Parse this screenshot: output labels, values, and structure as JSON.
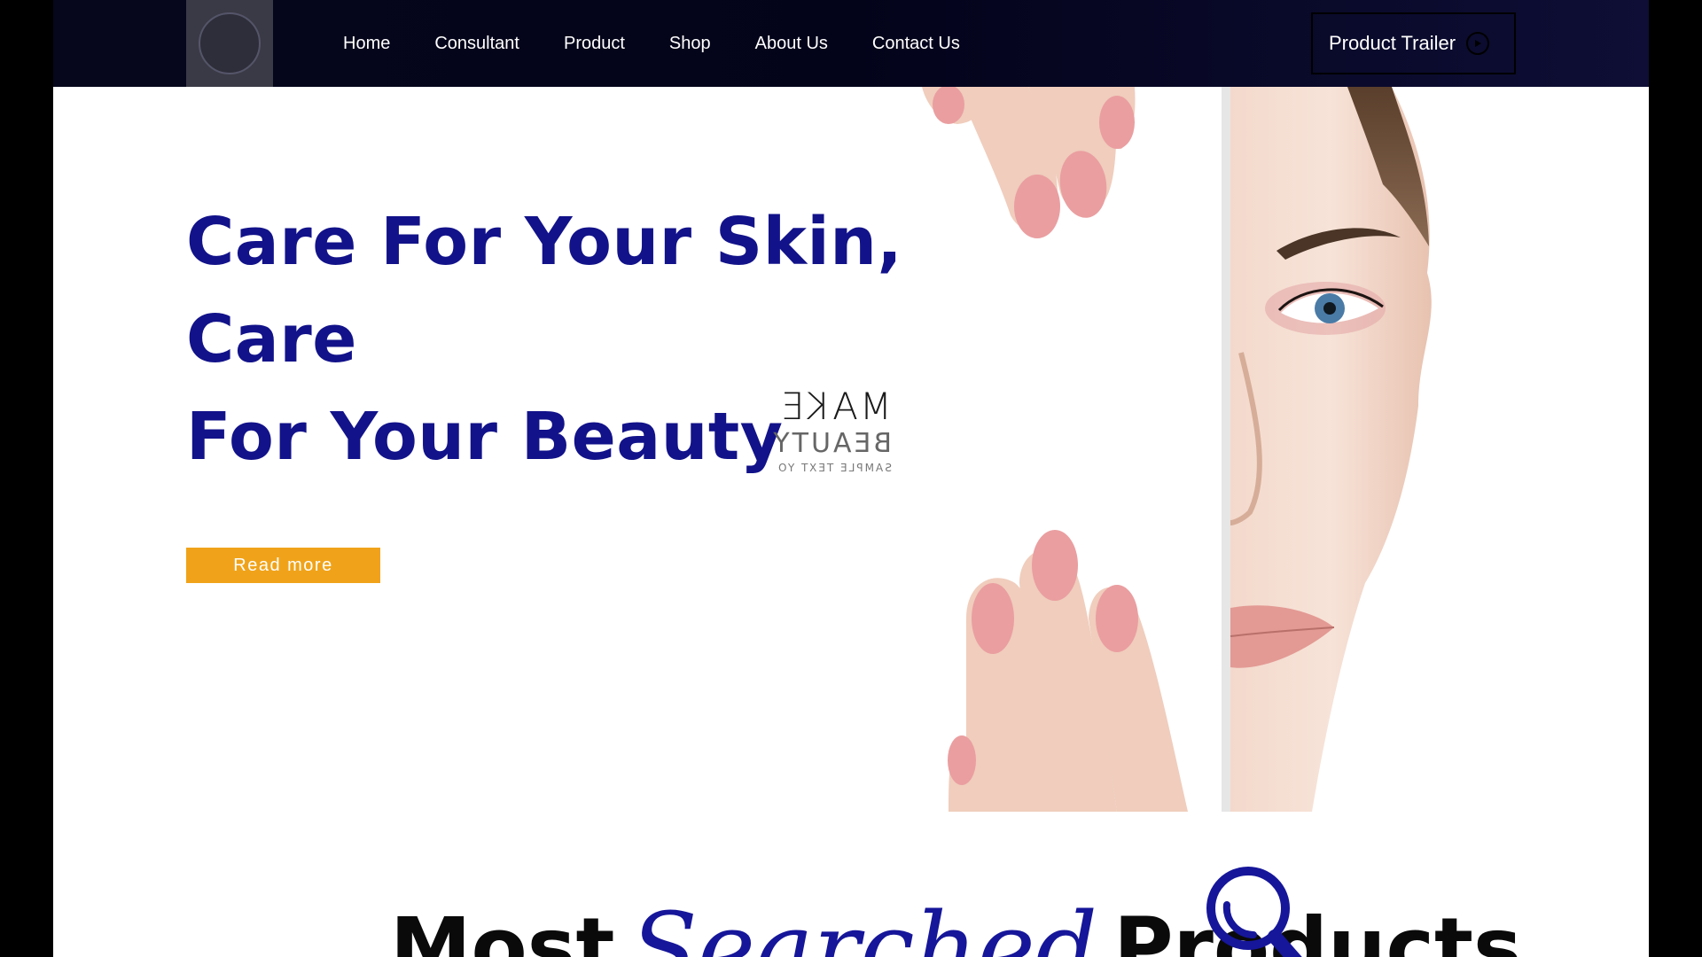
{
  "nav": {
    "items": [
      {
        "label": "Home"
      },
      {
        "label": "Consultant"
      },
      {
        "label": "Product"
      },
      {
        "label": "Shop"
      },
      {
        "label": "About Us"
      },
      {
        "label": "Contact Us"
      }
    ],
    "trailer_label": "Product Trailer"
  },
  "hero": {
    "title_line1": "Care For Your Skin, Care",
    "title_line2": "For Your Beauty",
    "button_label": "Read more",
    "brand_mirrored": {
      "line1": "MAKE",
      "line2": "BEAUTY",
      "line3": "SAMPLE TEXT YO"
    }
  },
  "section": {
    "heading_before": "Most",
    "heading_script": "Searched",
    "heading_after": "Products"
  },
  "colors": {
    "accent_navy": "#12128a",
    "button_orange": "#f0a31a",
    "nav_bg": "#06061c"
  }
}
